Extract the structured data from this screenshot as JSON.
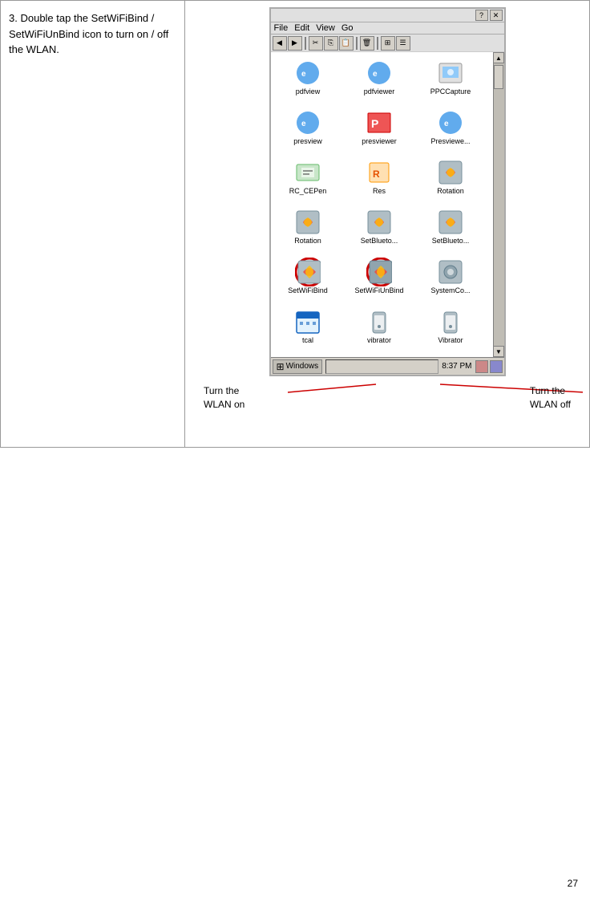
{
  "step": {
    "number": "3.",
    "text": "Double tap the SetWiFiBind / SetWiFiUnBind icon to turn on / off the WLAN."
  },
  "labels": {
    "turn_on": "Turn the\nWLAN on",
    "turn_off": "Turn the\nWLAN off"
  },
  "window": {
    "title": "",
    "menu_items": [
      "File",
      "Edit",
      "View",
      "Go"
    ],
    "icons": [
      {
        "name": "pdfview",
        "label": "pdfview"
      },
      {
        "name": "pdfviewer",
        "label": "pdfviewer"
      },
      {
        "name": "PPCCapture",
        "label": "PPCCapture"
      },
      {
        "name": "presview",
        "label": "presview"
      },
      {
        "name": "presviewer",
        "label": "presviewer"
      },
      {
        "name": "Presviewe...",
        "label": "Presviewe..."
      },
      {
        "name": "RC_CEPen",
        "label": "RC_CEPen"
      },
      {
        "name": "Res",
        "label": "Res"
      },
      {
        "name": "Rotation",
        "label": "Rotation"
      },
      {
        "name": "Rotation2",
        "label": "Rotation"
      },
      {
        "name": "SetBlueto1",
        "label": "SetBlueto..."
      },
      {
        "name": "SetBlueto2",
        "label": "SetBlueto..."
      },
      {
        "name": "SetWiFiBind",
        "label": "SetWiFiBind",
        "highlighted": true
      },
      {
        "name": "SetWiFiUnBind",
        "label": "SetWiFiUnBind",
        "highlighted": true
      },
      {
        "name": "SystemCo",
        "label": "SystemCo..."
      },
      {
        "name": "tcal",
        "label": "tcal"
      },
      {
        "name": "vibrator",
        "label": "vibrator"
      },
      {
        "name": "Vibrator",
        "label": "Vibrator"
      }
    ],
    "taskbar": {
      "start_label": "Windows",
      "time": "8:37 PM"
    }
  },
  "page_number": "27"
}
